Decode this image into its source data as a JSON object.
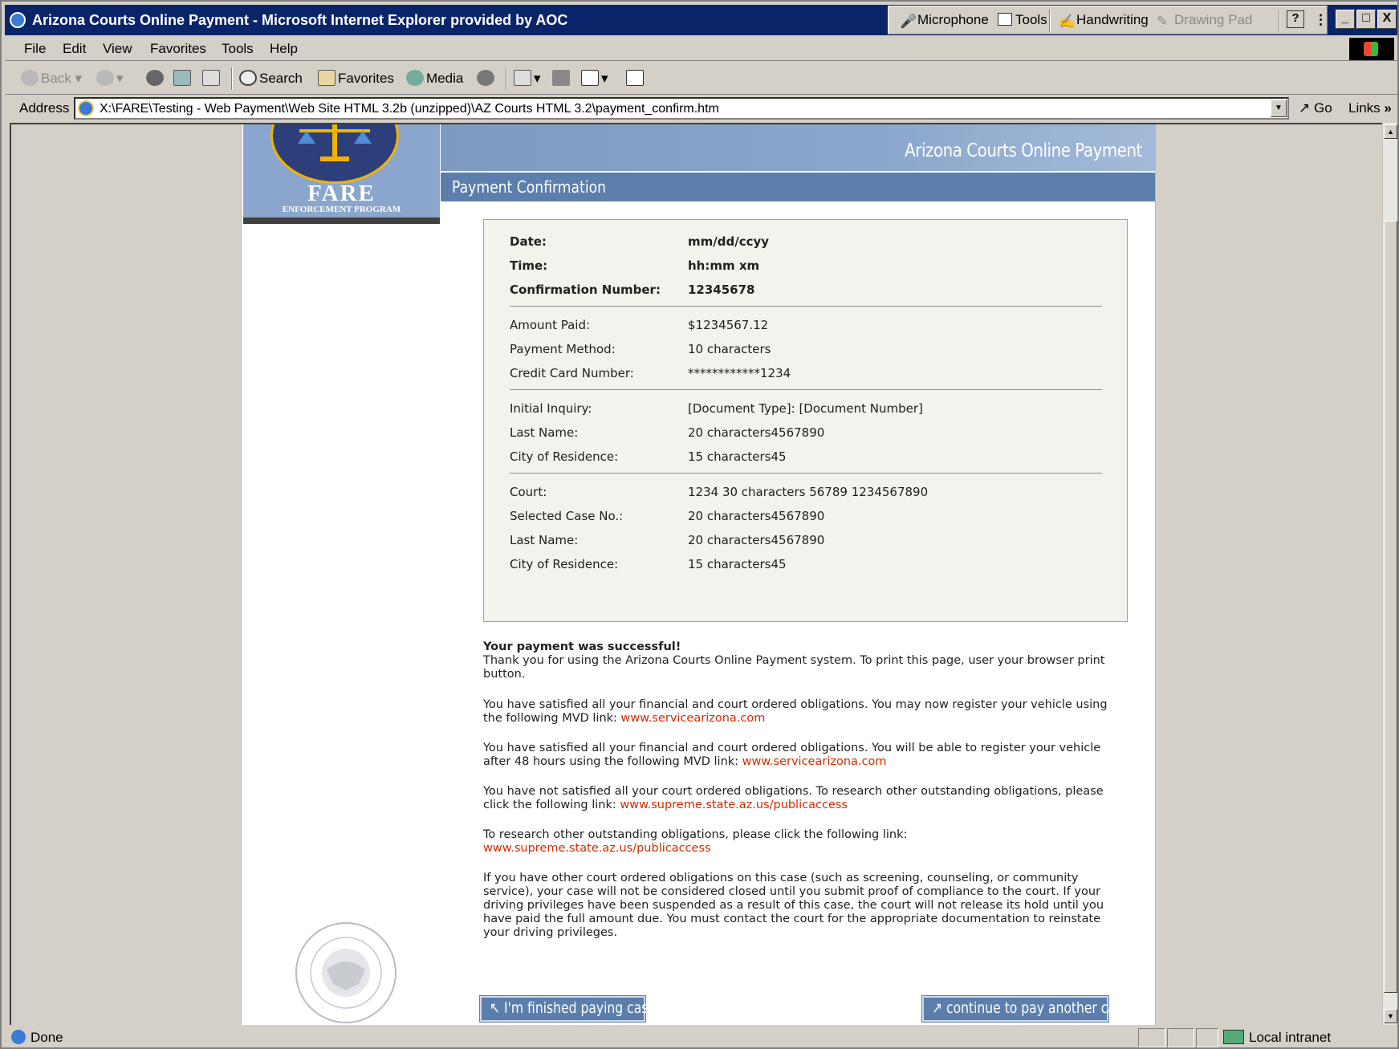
{
  "window": {
    "title": "Arizona Courts Online Payment - Microsoft Internet Explorer provided by AOC",
    "language_bar": {
      "microphone": "Microphone",
      "tools": "Tools",
      "handwriting": "Handwriting",
      "drawing_pad": "Drawing Pad",
      "help": "?"
    },
    "controls": {
      "minimize": "_",
      "maximize": "□",
      "close": "X"
    }
  },
  "menu": [
    "File",
    "Edit",
    "View",
    "Favorites",
    "Tools",
    "Help"
  ],
  "toolbar": {
    "back": "Back",
    "search": "Search",
    "favorites": "Favorites",
    "media": "Media"
  },
  "address": {
    "label": "Address",
    "url": "X:\\FARE\\Testing - Web Payment\\Web Site HTML 3.2b (unzipped)\\AZ Courts HTML 3.2\\payment_confirm.htm",
    "go": "Go",
    "links": "Links"
  },
  "header": {
    "logo_text": "FARE",
    "logo_subtext": "ENFORCEMENT PROGRAM",
    "site_title": "Arizona Courts Online Payment",
    "page_title": "Payment Confirmation"
  },
  "details": {
    "date_label": "Date:",
    "date_value": "mm/dd/ccyy",
    "time_label": "Time:",
    "time_value": "hh:mm xm",
    "conf_label": "Confirmation Number:",
    "conf_value": "12345678",
    "amount_label": "Amount Paid:",
    "amount_value": "$1234567.12",
    "method_label": "Payment Method:",
    "method_value": "10 characters",
    "card_label": "Credit Card Number:",
    "card_value": "************1234",
    "inquiry_label": "Initial Inquiry:",
    "inquiry_value": "[Document Type]: [Document Number]",
    "lastname1_label": "Last Name:",
    "lastname1_value": "20 characters4567890",
    "city1_label": "City of Residence:",
    "city1_value": "15 characters45",
    "court_label": "Court:",
    "court_value": "1234 30 characters 56789 1234567890",
    "case_label": "Selected Case No.:",
    "case_value": "20 characters4567890",
    "lastname2_label": "Last Name:",
    "lastname2_value": "20 characters4567890",
    "city2_label": "City of Residence:",
    "city2_value": "15 characters45"
  },
  "messages": {
    "success_heading": "Your payment was successful!",
    "thanks": "Thank you for using the Arizona Courts Online Payment system. To print this page, user your browser print button.",
    "msg1": "You have satisfied all your financial and court ordered obligations. You may now register your vehicle using the following MVD link: ",
    "msg1_link": "www.servicearizona.com",
    "msg2": "You have satisfied all your financial and court ordered obligations. You will be able to register your vehicle after 48 hours using the following MVD link: ",
    "msg2_link": "www.servicearizona.com",
    "msg3": "You have not satisfied all your court ordered obligations. To research other outstanding obligations, please click the following link: ",
    "msg3_link": "www.supreme.state.az.us/publicaccess",
    "msg4": "To research other outstanding obligations, please click the following link:",
    "msg4_link": "www.supreme.state.az.us/publicaccess",
    "msg5": "If you have other court ordered obligations on this case (such as screening, counseling, or community service), your case will not be considered closed until you submit proof of compliance to the court. If your driving privileges have been suspended as a result of this case, the court will not release its hold until you have paid the full amount due. You must contact the court for the appropriate documentation to reinstate your driving privileges."
  },
  "buttons": {
    "finished": "↖ I'm finished paying cases",
    "continue": "↗ continue to pay another case"
  },
  "status": {
    "text": "Done",
    "zone": "Local intranet"
  }
}
